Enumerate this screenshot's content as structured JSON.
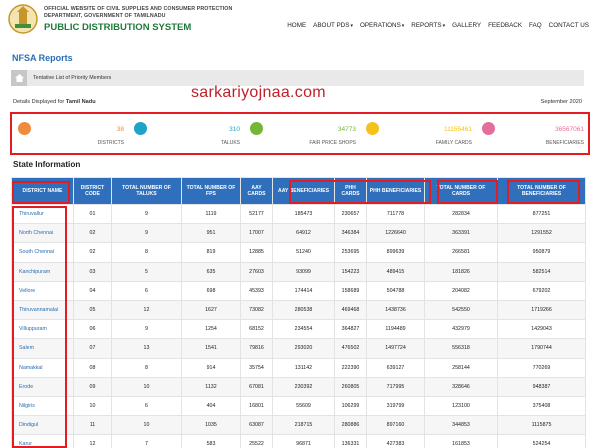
{
  "header": {
    "org_line1": "OFFICIAL WEBSITE OF CIVIL SUPPLIES AND CONSUMER PROTECTION",
    "org_line2": "DEPARTMENT, GOVERNMENT OF TAMILNADU",
    "org_title": "PUBLIC DISTRIBUTION SYSTEM",
    "nav": [
      "HOME",
      "ABOUT PDS",
      "OPERATIONS",
      "REPORTS",
      "GALLERY",
      "FEEDBACK",
      "FAQ",
      "CONTACT US"
    ]
  },
  "page_title": "NFSA Reports",
  "breadcrumb": "Tentative List of Priority Members",
  "details_label": "Details Displayed for",
  "details_state": "Tamil Nadu",
  "date": "September  2020",
  "watermark": "sarkariyojnaa.com",
  "stats": [
    {
      "value": "38",
      "label": "DISTRICTS",
      "color": "#f08a3c",
      "icon": "map-pin-icon"
    },
    {
      "value": "310",
      "label": "TALUKS",
      "color": "#1fa3c9",
      "icon": "location-icon"
    },
    {
      "value": "34773",
      "label": "FAIR PRICE SHOPS",
      "color": "#73b735",
      "icon": "shop-icon"
    },
    {
      "value": "11155461",
      "label": "FAMILY CARDS",
      "color": "#f4c21b",
      "icon": "card-icon"
    },
    {
      "value": "36567061",
      "label": "BENEFICIARIES",
      "color": "#e36e9a",
      "icon": "person-icon"
    }
  ],
  "section_title": "State Information",
  "table": {
    "headers": [
      "DISTRICT NAME",
      "DISTRICT CODE",
      "TOTAL NUMBER OF TALUKS",
      "TOTAL NUMBER OF FPS",
      "AAY CARDS",
      "AAY BENEFICIARIES",
      "PHH CARDS",
      "PHH BENEFICIARIES",
      "TOTAL NUMBER OF CARDS",
      "TOTAL NUMBER OF BENEFICIARIES"
    ],
    "rows": [
      [
        "Thiruvallur",
        "01",
        "9",
        "1119",
        "52177",
        "185473",
        "230657",
        "711778",
        "282834",
        "877251"
      ],
      [
        "North Chennai",
        "02",
        "9",
        "951",
        "17007",
        "64912",
        "346384",
        "1226640",
        "363391",
        "1291552"
      ],
      [
        "South Chennai",
        "02",
        "8",
        "819",
        "12885",
        "51240",
        "253695",
        "899639",
        "266581",
        "950879"
      ],
      [
        "Kanchipuram",
        "03",
        "5",
        "635",
        "27603",
        "93099",
        "154223",
        "489415",
        "181826",
        "582514"
      ],
      [
        "Vellore",
        "04",
        "6",
        "698",
        "45393",
        "174414",
        "158689",
        "504788",
        "204082",
        "679202"
      ],
      [
        "Thiruvannamalai",
        "05",
        "12",
        "1627",
        "73082",
        "280538",
        "469468",
        "1438736",
        "542550",
        "1719266"
      ],
      [
        "Villuppuram",
        "06",
        "9",
        "1254",
        "68152",
        "234554",
        "364827",
        "1194489",
        "432979",
        "1429043"
      ],
      [
        "Salem",
        "07",
        "13",
        "1541",
        "79816",
        "293020",
        "476502",
        "1497724",
        "556318",
        "1790744"
      ],
      [
        "Namakkal",
        "08",
        "8",
        "914",
        "35754",
        "131142",
        "222390",
        "639127",
        "258144",
        "770269"
      ],
      [
        "Erode",
        "09",
        "10",
        "1132",
        "67081",
        "230392",
        "260805",
        "717995",
        "328646",
        "948387"
      ],
      [
        "Nilgiris",
        "10",
        "6",
        "404",
        "16801",
        "55609",
        "106299",
        "319799",
        "123100",
        "375408"
      ],
      [
        "Dindigul",
        "11",
        "10",
        "1035",
        "63087",
        "218715",
        "280886",
        "897160",
        "344853",
        "1115875"
      ],
      [
        "Karur",
        "12",
        "7",
        "583",
        "25522",
        "96871",
        "136331",
        "427383",
        "161853",
        "524254"
      ]
    ]
  }
}
